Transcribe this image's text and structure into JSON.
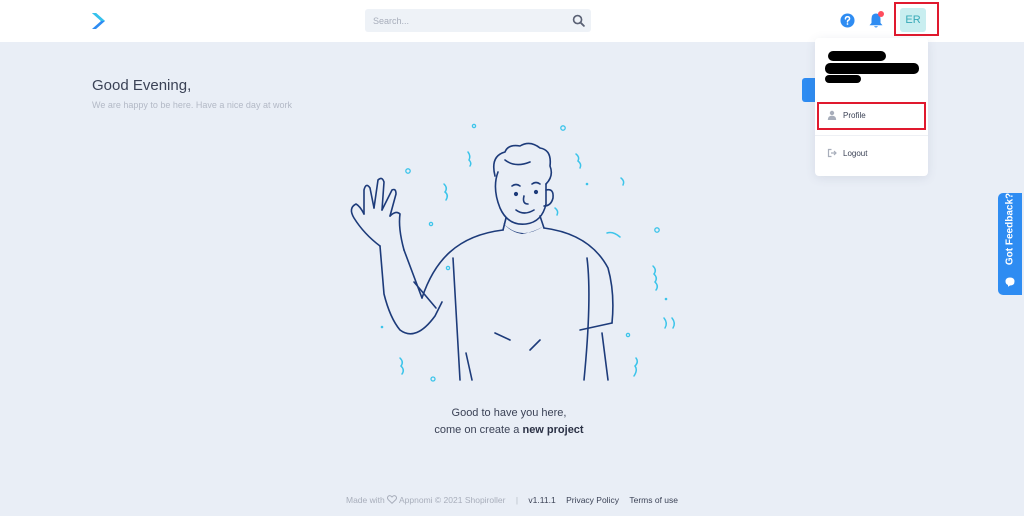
{
  "header": {
    "search_placeholder": "Search...",
    "avatar_initials": "ER"
  },
  "greeting": {
    "title": "Good Evening,",
    "subtitle": "We are happy to be here. Have a nice day at work"
  },
  "user_menu": {
    "items": [
      {
        "label": "Profile",
        "icon": "user-icon"
      },
      {
        "label": "Logout",
        "icon": "logout-icon"
      }
    ]
  },
  "feedback": {
    "label": "Got Feedback?"
  },
  "welcome": {
    "line1": "Good to have you here,",
    "line2_prefix": "come on create a ",
    "line2_link": "new project"
  },
  "footer": {
    "made_with": "Made with",
    "brand": "Appnomi © 2021 Shopiroller",
    "version": "v1.11.1",
    "privacy": "Privacy Policy",
    "terms": "Terms of use"
  },
  "colors": {
    "background": "#e9eef6",
    "accent_blue": "#2e8cf2",
    "avatar_bg": "#c9eef0",
    "highlight_red": "#e0192e",
    "illustration_line": "#1d3b7a",
    "confetti": "#3cc4ea"
  }
}
